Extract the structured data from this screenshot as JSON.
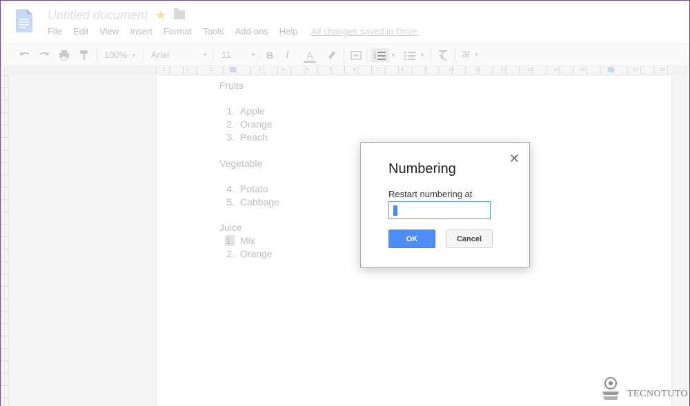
{
  "header": {
    "title": "Untitled document",
    "menu": [
      "File",
      "Edit",
      "View",
      "Insert",
      "Format",
      "Tools",
      "Add-ons",
      "Help"
    ],
    "save_status": "All changes saved in Drive"
  },
  "toolbar": {
    "zoom": "100%",
    "font": "Arial",
    "font_size": "11"
  },
  "ruler": {
    "labels": [
      "2",
      "1",
      "1",
      "1",
      "2",
      "3",
      "4",
      "5",
      "6",
      "7",
      "8",
      "9",
      "10",
      "11",
      "12",
      "13",
      "14",
      "15",
      "16",
      "17",
      "18"
    ]
  },
  "document": {
    "sections": [
      {
        "heading": "Fruits",
        "items": [
          {
            "num": "1.",
            "text": "Apple"
          },
          {
            "num": "2.",
            "text": "Orange"
          },
          {
            "num": "3.",
            "text": "Peach"
          }
        ]
      },
      {
        "heading": "Vegetable",
        "items": [
          {
            "num": "4.",
            "text": "Potato"
          },
          {
            "num": "5.",
            "text": "Cabbage"
          }
        ]
      },
      {
        "heading": "Juice",
        "items": [
          {
            "num": "1.",
            "text": "Mix"
          },
          {
            "num": "2.",
            "text": "Orange"
          }
        ]
      }
    ]
  },
  "dialog": {
    "title": "Numbering",
    "label": "Restart numbering at",
    "value": "1",
    "ok_label": "OK",
    "cancel_label": "Cancel"
  },
  "watermark": {
    "text": "TECNOTUTO"
  },
  "colors": {
    "accent": "#4d8ff5",
    "dialog_border": "#acacac",
    "page_text": "#bdbdbd"
  }
}
